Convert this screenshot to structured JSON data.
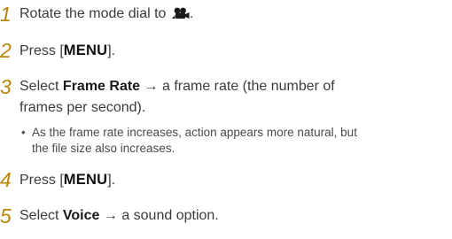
{
  "steps": [
    {
      "number": "1",
      "text": "Rotate the mode dial to",
      "icon": "movie-camera-icon",
      "suffix": "."
    },
    {
      "number": "2",
      "prefix": "Press [",
      "key": "MENU",
      "suffix": "]."
    },
    {
      "number": "3",
      "prefix": "Select ",
      "bold": "Frame Rate",
      "text": " → a frame rate (the number of",
      "continuation": "frames per second)."
    },
    {
      "number": "4",
      "prefix": "Press [",
      "key": "MENU",
      "suffix": "]."
    },
    {
      "number": "5",
      "prefix": "Select ",
      "bold": "Voice",
      "text": " → a sound option."
    }
  ],
  "note": {
    "bullet": "•",
    "line1": "As the frame rate increases, action appears more natural, but",
    "line2": "the file size also increases."
  }
}
